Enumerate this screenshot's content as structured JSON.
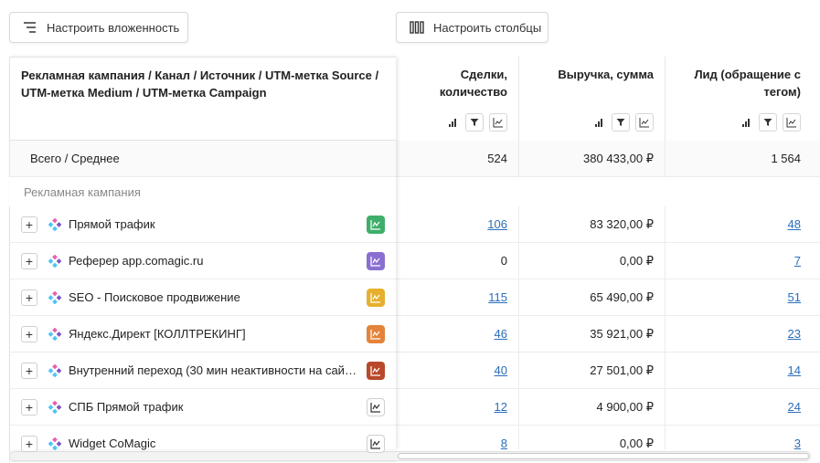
{
  "toolbar": {
    "nest_label": "Настроить вложенность",
    "cols_label": "Настроить столбцы"
  },
  "table": {
    "dimension_header": "Рекламная кампания / Канал / Источник / UTM-метка Source / UTM-метка Medium / UTM-метка Campaign",
    "columns": [
      {
        "label": "Сделки, количество"
      },
      {
        "label": "Выручка, сумма"
      },
      {
        "label": "Лид (обращение с тегом)"
      }
    ],
    "total": {
      "label": "Всего / Среднее",
      "values": [
        "524",
        "380 433,00 ₽",
        "1 564"
      ]
    },
    "group_label": "Рекламная кампания",
    "rows": [
      {
        "label": "Прямой трафик",
        "badge_color": "#3fae6a",
        "badge_style": "filled",
        "values": [
          "106",
          "83 320,00 ₽",
          "48"
        ],
        "links": [
          true,
          false,
          true
        ]
      },
      {
        "label": "Реферер app.comagic.ru",
        "badge_color": "#8a6fd1",
        "badge_style": "filled",
        "values": [
          "0",
          "0,00 ₽",
          "7"
        ],
        "links": [
          false,
          false,
          true
        ]
      },
      {
        "label": "SEO - Поисковое продвижение",
        "badge_color": "#e6b02e",
        "badge_style": "filled",
        "values": [
          "115",
          "65 490,00 ₽",
          "51"
        ],
        "links": [
          true,
          false,
          true
        ]
      },
      {
        "label": "Яндекс.Директ [КОЛЛТРЕКИНГ]",
        "badge_color": "#e3843a",
        "badge_style": "filled",
        "values": [
          "46",
          "35 921,00 ₽",
          "23"
        ],
        "links": [
          true,
          false,
          true
        ]
      },
      {
        "label": "Внутренний переход (30 мин неактивности на сайт…",
        "badge_color": "#b8492a",
        "badge_style": "filled",
        "values": [
          "40",
          "27 501,00 ₽",
          "14"
        ],
        "links": [
          true,
          false,
          true
        ]
      },
      {
        "label": "СПБ Прямой трафик",
        "badge_color": "#555555",
        "badge_style": "outline",
        "values": [
          "12",
          "4 900,00 ₽",
          "24"
        ],
        "links": [
          true,
          false,
          true
        ]
      },
      {
        "label": "Widget CoMagic",
        "badge_color": "#555555",
        "badge_style": "outline",
        "values": [
          "8",
          "0,00 ₽",
          "3"
        ],
        "links": [
          true,
          false,
          true
        ]
      }
    ]
  },
  "icons": {
    "nest": "nesting-icon",
    "cols": "columns-icon",
    "sort": "sort-bars-icon",
    "filter": "filter-icon",
    "chart": "chart-icon",
    "expand": "plus-icon",
    "source": "diamond-icon",
    "trend": "trend-chart-icon"
  },
  "colors": {
    "link": "#2a6ebb",
    "diamond_top": "#e85fb0",
    "diamond_left": "#4fc3f7",
    "diamond_right": "#7e57c2",
    "diamond_bottom": "#4fc3f7"
  }
}
